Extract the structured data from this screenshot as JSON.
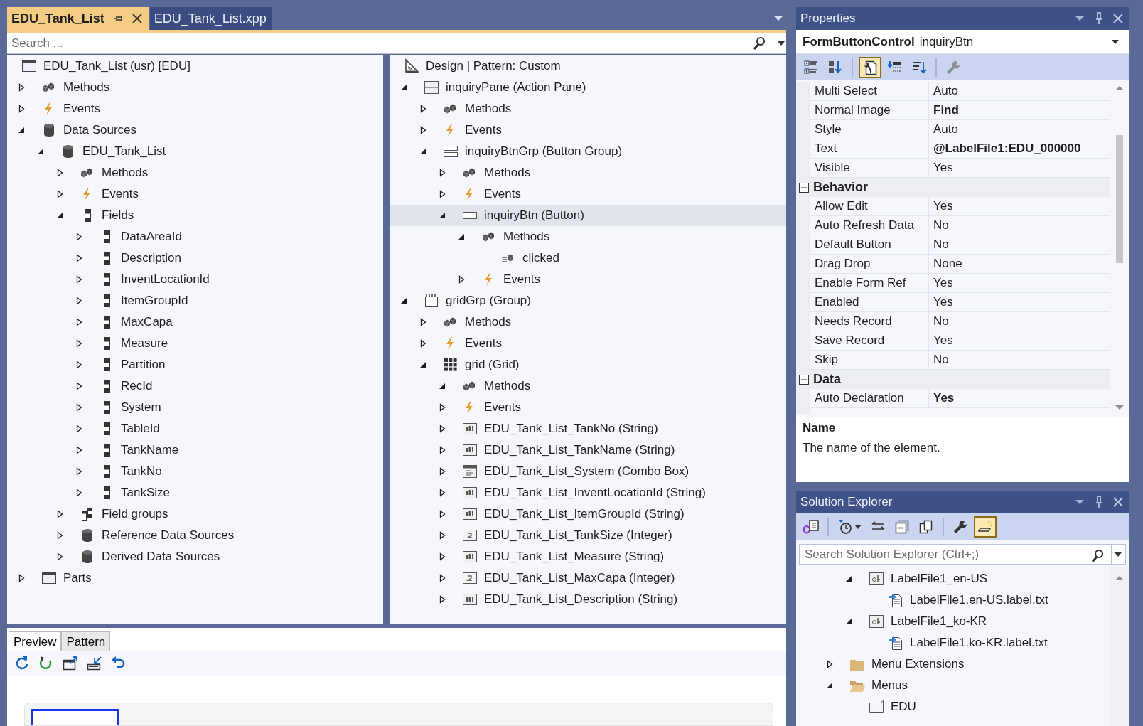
{
  "document_tabs": [
    {
      "label": "EDU_Tank_List",
      "selected": true
    },
    {
      "label": "EDU_Tank_List.xpp",
      "selected": false
    }
  ],
  "search": {
    "placeholder": "Search ..."
  },
  "left_tree": {
    "root": {
      "label": "EDU_Tank_List (usr) [EDU]",
      "kind": "form",
      "selected": false
    },
    "items": [
      {
        "label": "Methods",
        "kind": "methods",
        "expanded": false,
        "selected": false
      },
      {
        "label": "Events",
        "kind": "events",
        "expanded": false,
        "selected": false
      },
      {
        "label": "Data Sources",
        "kind": "datasource",
        "expanded": true,
        "selected": false,
        "children": [
          {
            "label": "EDU_Tank_List",
            "kind": "datasource",
            "expanded": true,
            "selected": false,
            "children": [
              {
                "label": "Methods",
                "kind": "methods",
                "expanded": false,
                "selected": false
              },
              {
                "label": "Events",
                "kind": "events",
                "expanded": false,
                "selected": false
              },
              {
                "label": "Fields",
                "kind": "field",
                "expanded": true,
                "selected": false,
                "children": [
                  {
                    "label": "DataAreaId",
                    "kind": "field",
                    "expanded": false,
                    "selected": false
                  },
                  {
                    "label": "Description",
                    "kind": "field",
                    "expanded": false,
                    "selected": false
                  },
                  {
                    "label": "InventLocationId",
                    "kind": "field",
                    "expanded": false,
                    "selected": false
                  },
                  {
                    "label": "ItemGroupId",
                    "kind": "field",
                    "expanded": false,
                    "selected": false
                  },
                  {
                    "label": "MaxCapa",
                    "kind": "field",
                    "expanded": false,
                    "selected": false
                  },
                  {
                    "label": "Measure",
                    "kind": "field",
                    "expanded": false,
                    "selected": false
                  },
                  {
                    "label": "Partition",
                    "kind": "field",
                    "expanded": false,
                    "selected": false
                  },
                  {
                    "label": "RecId",
                    "kind": "field",
                    "expanded": false,
                    "selected": false
                  },
                  {
                    "label": "System",
                    "kind": "field",
                    "expanded": false,
                    "selected": false
                  },
                  {
                    "label": "TableId",
                    "kind": "field",
                    "expanded": false,
                    "selected": false
                  },
                  {
                    "label": "TankName",
                    "kind": "field",
                    "expanded": false,
                    "selected": false
                  },
                  {
                    "label": "TankNo",
                    "kind": "field",
                    "expanded": false,
                    "selected": false
                  },
                  {
                    "label": "TankSize",
                    "kind": "field",
                    "expanded": false,
                    "selected": false
                  }
                ]
              },
              {
                "label": "Field groups",
                "kind": "fieldgroups",
                "expanded": false,
                "selected": false
              },
              {
                "label": "Reference Data Sources",
                "kind": "datasource",
                "expanded": false,
                "selected": false
              },
              {
                "label": "Derived Data Sources",
                "kind": "datasource",
                "expanded": false,
                "selected": false
              }
            ]
          }
        ]
      },
      {
        "label": "Parts",
        "kind": "parts",
        "expanded": false,
        "selected": false
      }
    ]
  },
  "right_tree": {
    "root": {
      "label": "Design | Pattern: Custom",
      "kind": "design",
      "selected": false
    },
    "items": [
      {
        "label": "inquiryPane (Action Pane)",
        "kind": "actionpane",
        "expanded": true,
        "selected": false,
        "children": [
          {
            "label": "Methods",
            "kind": "methods",
            "expanded": false,
            "selected": false
          },
          {
            "label": "Events",
            "kind": "events",
            "expanded": false,
            "selected": false
          },
          {
            "label": "inquiryBtnGrp (Button Group)",
            "kind": "buttongroup",
            "expanded": true,
            "selected": false,
            "children": [
              {
                "label": "Methods",
                "kind": "methods",
                "expanded": false,
                "selected": false
              },
              {
                "label": "Events",
                "kind": "events",
                "expanded": false,
                "selected": false
              },
              {
                "label": "inquiryBtn (Button)",
                "kind": "button",
                "expanded": true,
                "selected": true,
                "children": [
                  {
                    "label": "Methods",
                    "kind": "methods",
                    "expanded": true,
                    "selected": false,
                    "children": [
                      {
                        "label": "clicked",
                        "kind": "method",
                        "selected": false
                      }
                    ]
                  },
                  {
                    "label": "Events",
                    "kind": "events",
                    "expanded": false,
                    "selected": false
                  }
                ]
              }
            ]
          }
        ]
      },
      {
        "label": "gridGrp (Group)",
        "kind": "group",
        "expanded": true,
        "selected": false,
        "children": [
          {
            "label": "Methods",
            "kind": "methods",
            "expanded": false,
            "selected": false
          },
          {
            "label": "Events",
            "kind": "events",
            "expanded": false,
            "selected": false
          },
          {
            "label": "grid (Grid)",
            "kind": "grid",
            "expanded": true,
            "selected": false,
            "children": [
              {
                "label": "Methods",
                "kind": "methods",
                "expanded": true,
                "selected": false
              },
              {
                "label": "Events",
                "kind": "events",
                "expanded": false,
                "selected": false
              },
              {
                "label": "EDU_Tank_List_TankNo (String)",
                "kind": "string",
                "expanded": false,
                "selected": false
              },
              {
                "label": "EDU_Tank_List_TankName (String)",
                "kind": "string",
                "expanded": false,
                "selected": false
              },
              {
                "label": "EDU_Tank_List_System (Combo Box)",
                "kind": "combobox",
                "expanded": false,
                "selected": false
              },
              {
                "label": "EDU_Tank_List_InventLocationId (String)",
                "kind": "string",
                "expanded": false,
                "selected": false
              },
              {
                "label": "EDU_Tank_List_ItemGroupId (String)",
                "kind": "string",
                "expanded": false,
                "selected": false
              },
              {
                "label": "EDU_Tank_List_TankSize (Integer)",
                "kind": "integer",
                "expanded": false,
                "selected": false
              },
              {
                "label": "EDU_Tank_List_Measure (String)",
                "kind": "string",
                "expanded": false,
                "selected": false
              },
              {
                "label": "EDU_Tank_List_MaxCapa (Integer)",
                "kind": "integer",
                "expanded": false,
                "selected": false
              },
              {
                "label": "EDU_Tank_List_Description (String)",
                "kind": "string",
                "expanded": false,
                "selected": false
              }
            ]
          }
        ]
      }
    ]
  },
  "bottom_tabs": [
    {
      "label": "Preview",
      "selected": true
    },
    {
      "label": "Pattern",
      "selected": false
    }
  ],
  "preview_toolbar": [
    {
      "kind": "refresh"
    },
    {
      "kind": "refresh-green"
    },
    {
      "kind": "pop-out"
    },
    {
      "kind": "dock"
    },
    {
      "kind": "undo"
    }
  ],
  "properties": {
    "title": "Properties",
    "object_type": "FormButtonControl",
    "object_name": "inquiryBtn",
    "toolbar": [
      {
        "kind": "categorized",
        "selected": false
      },
      {
        "kind": "alphabetical",
        "selected": false
      },
      {
        "kind": "properties",
        "selected": true
      },
      {
        "kind": "events",
        "selected": false
      },
      {
        "kind": "sort",
        "selected": false
      },
      {
        "kind": "settings",
        "selected": false
      }
    ],
    "rows": [
      {
        "kind": "property",
        "name": "Multi Select",
        "value": "Auto",
        "bold": false
      },
      {
        "kind": "property",
        "name": "Normal Image",
        "value": "Find",
        "bold": true
      },
      {
        "kind": "property",
        "name": "Style",
        "value": "Auto",
        "bold": false
      },
      {
        "kind": "property",
        "name": "Text",
        "value": "@LabelFile1:EDU_000000",
        "bold": true
      },
      {
        "kind": "property",
        "name": "Visible",
        "value": "Yes",
        "bold": false
      },
      {
        "kind": "category",
        "name": "Behavior",
        "expanded": true
      },
      {
        "kind": "property",
        "name": "Allow Edit",
        "value": "Yes",
        "bold": false
      },
      {
        "kind": "property",
        "name": "Auto Refresh Data",
        "value": "No",
        "bold": false
      },
      {
        "kind": "property",
        "name": "Default Button",
        "value": "No",
        "bold": false
      },
      {
        "kind": "property",
        "name": "Drag Drop",
        "value": "None",
        "bold": false
      },
      {
        "kind": "property",
        "name": "Enable Form Ref",
        "value": "Yes",
        "bold": false
      },
      {
        "kind": "property",
        "name": "Enabled",
        "value": "Yes",
        "bold": false
      },
      {
        "kind": "property",
        "name": "Needs Record",
        "value": "No",
        "bold": false
      },
      {
        "kind": "property",
        "name": "Save Record",
        "value": "Yes",
        "bold": false
      },
      {
        "kind": "property",
        "name": "Skip",
        "value": "No",
        "bold": false
      },
      {
        "kind": "category",
        "name": "Data",
        "expanded": true
      },
      {
        "kind": "property",
        "name": "Auto Declaration",
        "value": "Yes",
        "bold": true
      }
    ],
    "description": {
      "title": "Name",
      "text": "The name of the element."
    }
  },
  "solution_explorer": {
    "title": "Solution Explorer",
    "toolbar": [
      {
        "kind": "home",
        "selected": false
      },
      {
        "kind": "history",
        "selected": false
      },
      {
        "kind": "sync",
        "selected": false
      },
      {
        "kind": "collapse",
        "selected": false
      },
      {
        "kind": "copy",
        "selected": false
      },
      {
        "kind": "settings",
        "selected": false
      },
      {
        "kind": "preview",
        "selected": true
      }
    ],
    "search": {
      "placeholder": "Search Solution Explorer (Ctrl+;)"
    },
    "items": [
      {
        "children": [
          {
            "label": "LabelFile1_en-US",
            "kind": "labelfile",
            "expanded": true,
            "selected": false,
            "children": [
              {
                "label": "LabelFile1.en-US.label.txt",
                "kind": "labeltxt",
                "selected": false
              }
            ]
          },
          {
            "label": "LabelFile1_ko-KR",
            "kind": "labelfile",
            "expanded": true,
            "selected": false,
            "children": [
              {
                "label": "LabelFile1.ko-KR.label.txt",
                "kind": "labeltxt",
                "selected": false
              }
            ]
          }
        ]
      },
      {
        "label": "Menu Extensions",
        "kind": "folder",
        "expanded": false,
        "selected": false
      },
      {
        "label": "Menus",
        "kind": "folder",
        "expanded": true,
        "selected": false,
        "children": [
          {
            "label": "EDU",
            "kind": "menu",
            "selected": false
          }
        ]
      }
    ]
  }
}
